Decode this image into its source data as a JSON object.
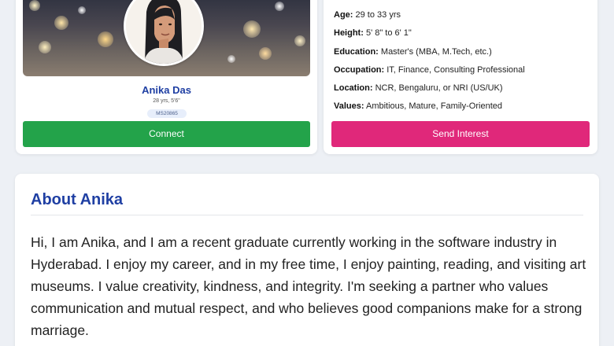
{
  "profile": {
    "name": "Anika Das",
    "meta": "28 yrs, 5'6\"",
    "id_badge": "MS20865",
    "connect_label": "Connect"
  },
  "preferences": {
    "items": [
      {
        "label": "Age:",
        "value": "29 to 33 yrs"
      },
      {
        "label": "Height:",
        "value": "5' 8\" to 6' 1\""
      },
      {
        "label": "Education:",
        "value": "Master's (MBA, M.Tech, etc.)"
      },
      {
        "label": "Occupation:",
        "value": "IT, Finance, Consulting Professional"
      },
      {
        "label": "Location:",
        "value": "NCR, Bengaluru, or NRI (US/UK)"
      },
      {
        "label": "Values:",
        "value": "Ambitious, Mature, Family-Oriented"
      }
    ],
    "send_interest_label": "Send Interest"
  },
  "about": {
    "title": "About Anika",
    "text": "Hi, I am Anika, and I am a recent graduate currently working in the software industry in Hyderabad. I enjoy my career, and in my free time, I enjoy painting, reading, and visiting art museums. I value creativity, kindness, and integrity. I'm seeking a partner who values communication and mutual respect, and who believes good companions make for a strong marriage."
  },
  "colors": {
    "accent_blue": "#1f3fa3",
    "connect_green": "#23a34a",
    "interest_pink": "#e0287a"
  }
}
